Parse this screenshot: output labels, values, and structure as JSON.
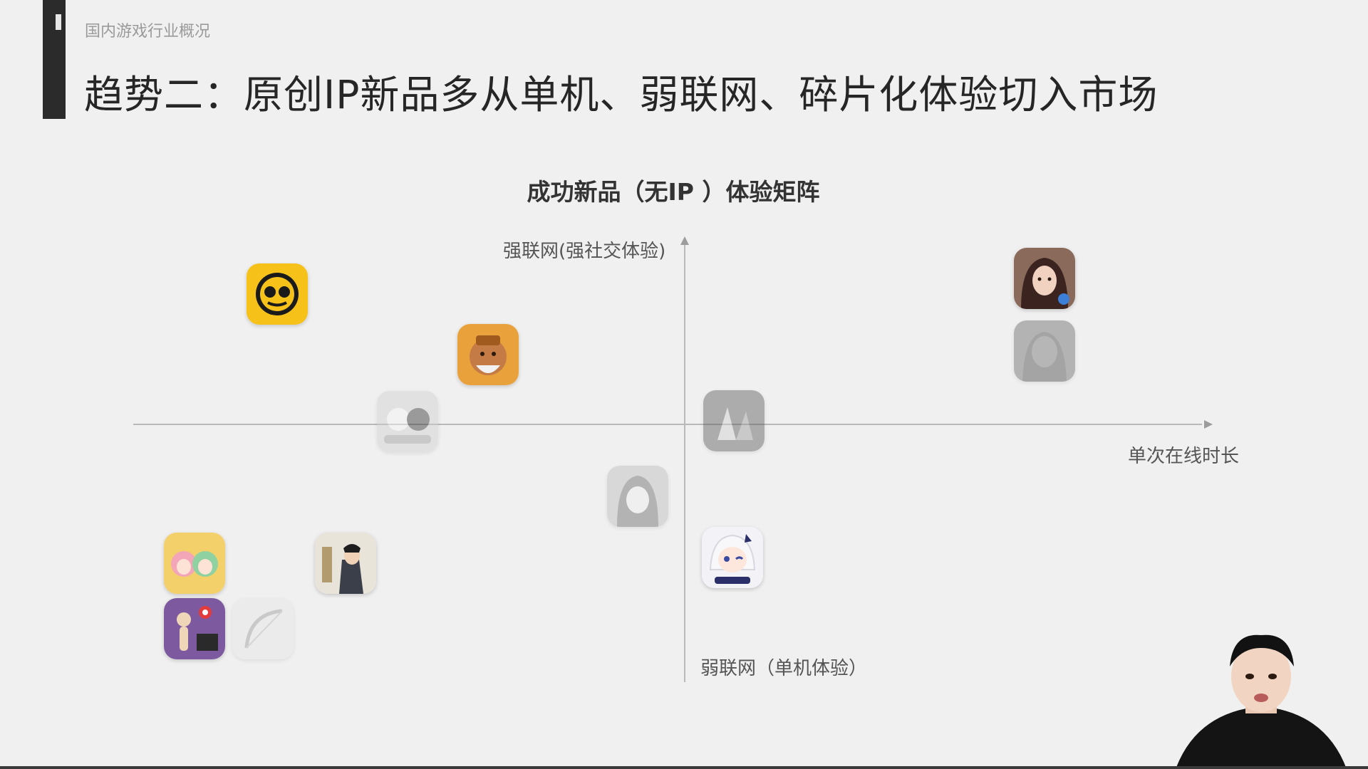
{
  "header": {
    "breadcrumb": "国内游戏行业概况",
    "title": "趋势二：原创IP新品多从单机、弱联网、碎片化体验切入市场"
  },
  "matrix": {
    "title": "成功新品（无IP ）体验矩阵",
    "axis_top_label": "强联网(强社交体验)",
    "axis_right_label": "单次在线时长",
    "axis_bottom_label": "弱联网（单机体验）"
  },
  "colors": {
    "accent_bar": "#2b2b2b",
    "background": "#f0f0f0",
    "axis": "#b9b9b9"
  },
  "icons": [
    "brawl-app-icon",
    "warrior-app-icon",
    "cute-creatures-app-icon",
    "mobile-rpg-girl-app-icon",
    "dark-fantasy-app-icon",
    "anime-girl-app-icon",
    "dark-mmo-app-icon",
    "chibi-guide-app-icon",
    "pink-anime-pair-app-icon",
    "scholar-app-icon",
    "puzzle-shooter-app-icon",
    "archery-app-icon"
  ]
}
